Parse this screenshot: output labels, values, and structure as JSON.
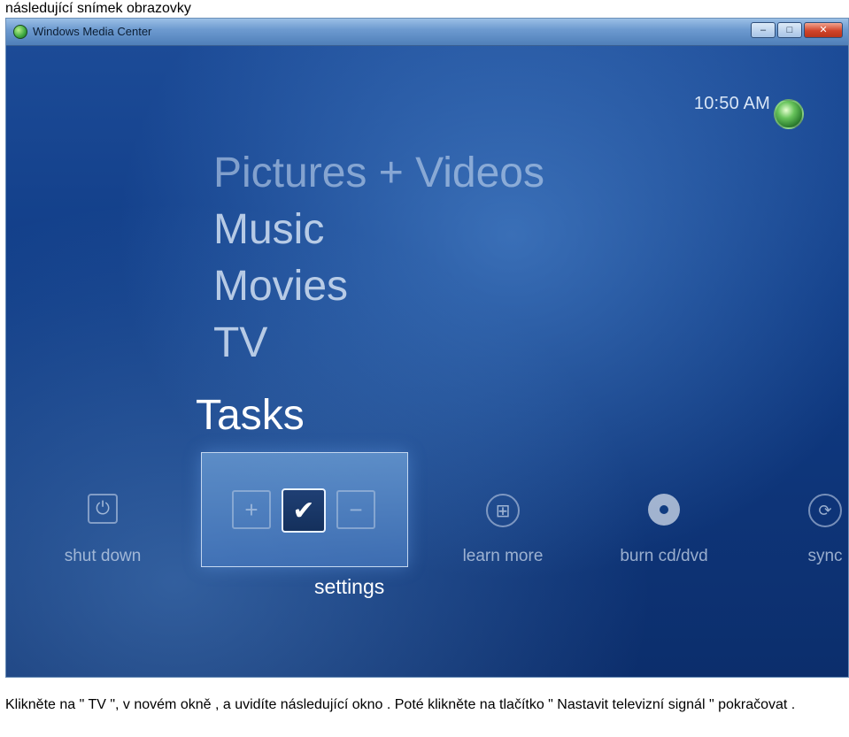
{
  "document": {
    "caption_top": "následující snímek obrazovky",
    "caption_bottom": "Klikněte na \" TV \", v novém okně , a uvidíte následující okno . Poté klikněte na tlačítko \" Nastavit televizní signál \" pokračovat ."
  },
  "window": {
    "title": "Windows Media Center",
    "controls": {
      "minimize": "–",
      "maximize": "□",
      "close": "✕"
    }
  },
  "header": {
    "clock": "10:50 AM"
  },
  "menu": {
    "items": [
      {
        "label": "Pictures + Videos"
      },
      {
        "label": "Music"
      },
      {
        "label": "Movies"
      },
      {
        "label": "TV"
      }
    ],
    "selected_section": "Tasks"
  },
  "tasks": {
    "shut_down": {
      "label": "shut down",
      "icon": "power-icon",
      "glyph": "⏻"
    },
    "settings": {
      "label": "settings",
      "selected": true,
      "buttons": {
        "plus": "+",
        "check": "✔",
        "minus": "−"
      }
    },
    "learn_more": {
      "label": "learn more",
      "icon": "windows-flag-icon",
      "glyph": "⊞"
    },
    "burn": {
      "label": "burn cd/dvd",
      "icon": "disc-icon"
    },
    "sync": {
      "label": "sync",
      "icon": "sync-icon",
      "glyph": "⟳"
    }
  },
  "colors": {
    "background": "#103c86",
    "text": "#dfe8f5",
    "highlight": "#ffffff"
  }
}
